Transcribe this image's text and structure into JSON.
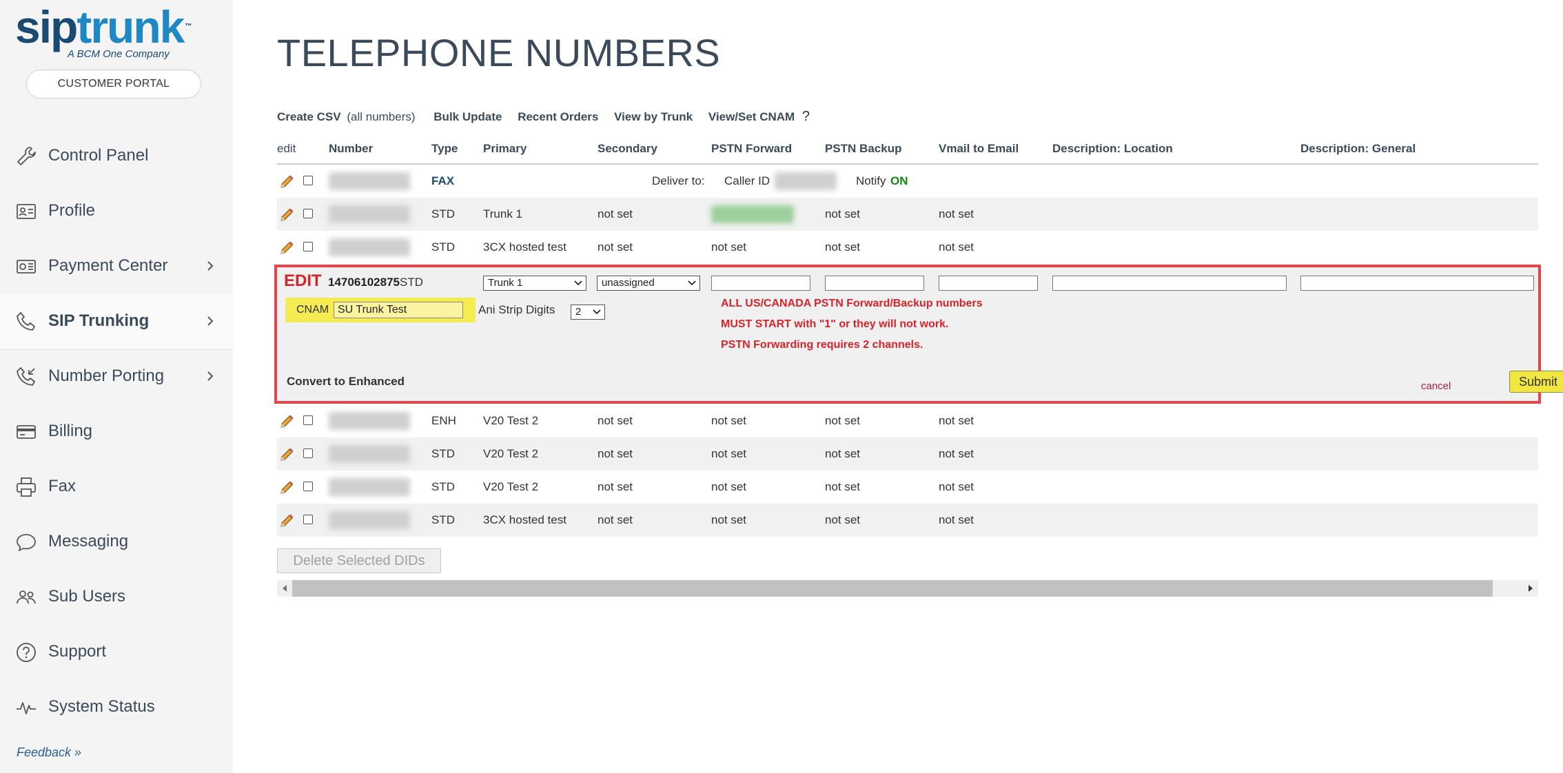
{
  "brand": {
    "logo_sip": "sip",
    "logo_trunk": "trunk",
    "tm": "™",
    "tagline": "A BCM One Company"
  },
  "portal_label": "CUSTOMER PORTAL",
  "nav": [
    {
      "label": "Control Panel",
      "icon": "wrench-icon"
    },
    {
      "label": "Profile",
      "icon": "profile-card-icon"
    },
    {
      "label": "Payment Center",
      "icon": "payment-icon"
    },
    {
      "label": "SIP Trunking",
      "icon": "phone-icon"
    },
    {
      "label": "Number Porting",
      "icon": "phone-incoming-icon"
    },
    {
      "label": "Billing",
      "icon": "credit-card-icon"
    },
    {
      "label": "Fax",
      "icon": "printer-icon"
    },
    {
      "label": "Messaging",
      "icon": "chat-bubble-icon"
    },
    {
      "label": "Sub Users",
      "icon": "users-icon"
    },
    {
      "label": "Support",
      "icon": "help-circle-icon"
    },
    {
      "label": "System Status",
      "icon": "pulse-icon"
    }
  ],
  "feedback": "Feedback »",
  "page_title": "TELEPHONE NUMBERS",
  "actions": {
    "create_csv": "Create CSV",
    "create_csv_note": "(all numbers)",
    "bulk_update": "Bulk Update",
    "recent_orders": "Recent Orders",
    "view_by_trunk": "View by Trunk",
    "view_set_cnam": "View/Set CNAM",
    "help": "?"
  },
  "columns": [
    "edit",
    "Number",
    "Type",
    "Primary",
    "Secondary",
    "PSTN Forward",
    "PSTN Backup",
    "Vmail to Email",
    "Description: Location",
    "Description: General"
  ],
  "fax_row": {
    "type": "FAX",
    "deliver_to": "Deliver to:",
    "caller_id": "Caller ID",
    "notify": "Notify",
    "notify_value": "ON"
  },
  "rows_top": [
    {
      "type": "STD",
      "primary": "Trunk 1",
      "secondary": "not set",
      "pstn_forward": "",
      "pstn_backup": "not set",
      "vmail": "not set"
    },
    {
      "type": "STD",
      "primary": "3CX hosted test",
      "secondary": "not set",
      "pstn_forward": "not set",
      "pstn_backup": "not set",
      "vmail": "not set"
    }
  ],
  "edit_row": {
    "edit_label": "EDIT",
    "number": "14706102875",
    "type": "STD",
    "primary_selected": "Trunk 1",
    "secondary_selected": "unassigned",
    "cnam_label": "CNAM",
    "cnam_value": "SU Trunk Test",
    "ani_label": "Ani Strip Digits",
    "ani_value": "2",
    "warnings": [
      "ALL US/CANADA PSTN Forward/Backup numbers",
      "MUST START with \"1\" or they will not work.",
      "PSTN Forwarding requires 2 channels."
    ],
    "convert": "Convert to Enhanced",
    "cancel": "cancel",
    "submit": "Submit"
  },
  "rows_bottom": [
    {
      "type": "ENH",
      "primary": "V20 Test 2",
      "secondary": "not set",
      "pstn_forward": "not set",
      "pstn_backup": "not set",
      "vmail": "not set"
    },
    {
      "type": "STD",
      "primary": "V20 Test 2",
      "secondary": "not set",
      "pstn_forward": "not set",
      "pstn_backup": "not set",
      "vmail": "not set"
    },
    {
      "type": "STD",
      "primary": "V20 Test 2",
      "secondary": "not set",
      "pstn_forward": "not set",
      "pstn_backup": "not set",
      "vmail": "not set"
    },
    {
      "type": "STD",
      "primary": "3CX hosted test",
      "secondary": "not set",
      "pstn_forward": "not set",
      "pstn_backup": "not set",
      "vmail": "not set"
    }
  ],
  "delete_label": "Delete Selected DIDs",
  "colors": {
    "accent_red": "#d8232a",
    "highlight_yellow": "#f5eb52",
    "nav_text": "#3a4a5a",
    "brand_blue": "#1a4a74",
    "brand_light_blue": "#1e87c4",
    "on_green": "#118811"
  }
}
